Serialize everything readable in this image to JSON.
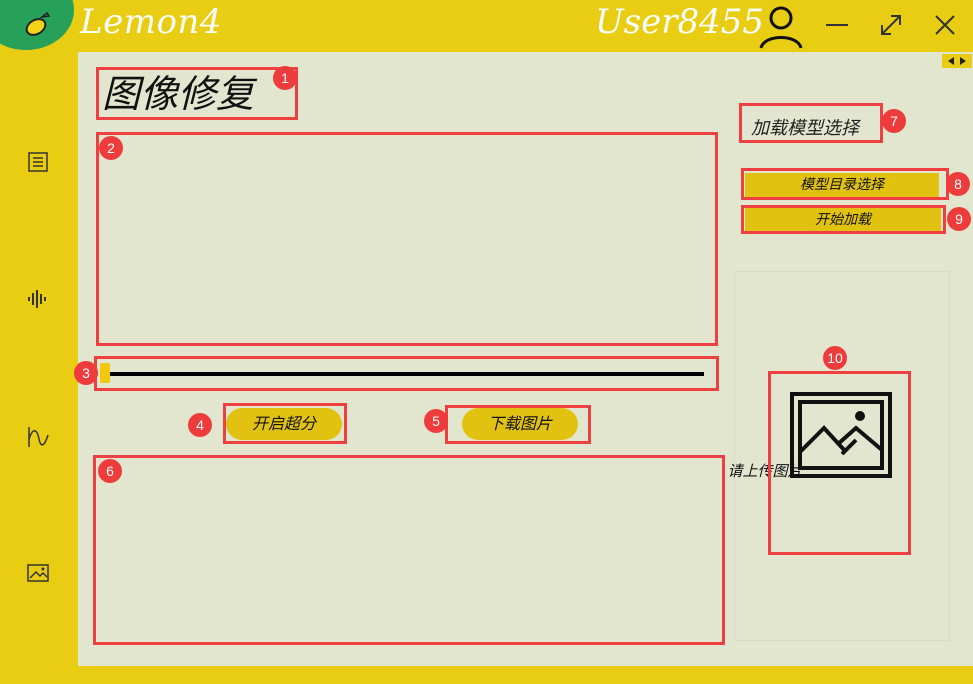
{
  "app": {
    "title": "Lemon4",
    "user": "User8455",
    "colors": {
      "accent": "#e9cd12",
      "content_bg": "#e3e6cf",
      "logo_green": "#27a05a",
      "annotation_red": "#ee4040"
    }
  },
  "window_controls": {
    "icons": [
      "minimize-icon",
      "maximize-icon",
      "close-icon"
    ]
  },
  "sidebar": {
    "items": [
      {
        "icon": "document-icon"
      },
      {
        "icon": "audio-wave-icon"
      },
      {
        "icon": "curve-icon"
      },
      {
        "icon": "image-icon"
      }
    ]
  },
  "main": {
    "page_title": "图像修复",
    "buttons": {
      "super_resolution": "开启超分",
      "download": "下载图片"
    },
    "slider": {
      "value": 0
    }
  },
  "model": {
    "label": "加载模型选择",
    "select_dir": "模型目录选择",
    "start_load": "开始加载"
  },
  "upload": {
    "caption": "请上传图片"
  },
  "annotations": [
    "1",
    "2",
    "3",
    "4",
    "5",
    "6",
    "7",
    "8",
    "9",
    "10"
  ]
}
